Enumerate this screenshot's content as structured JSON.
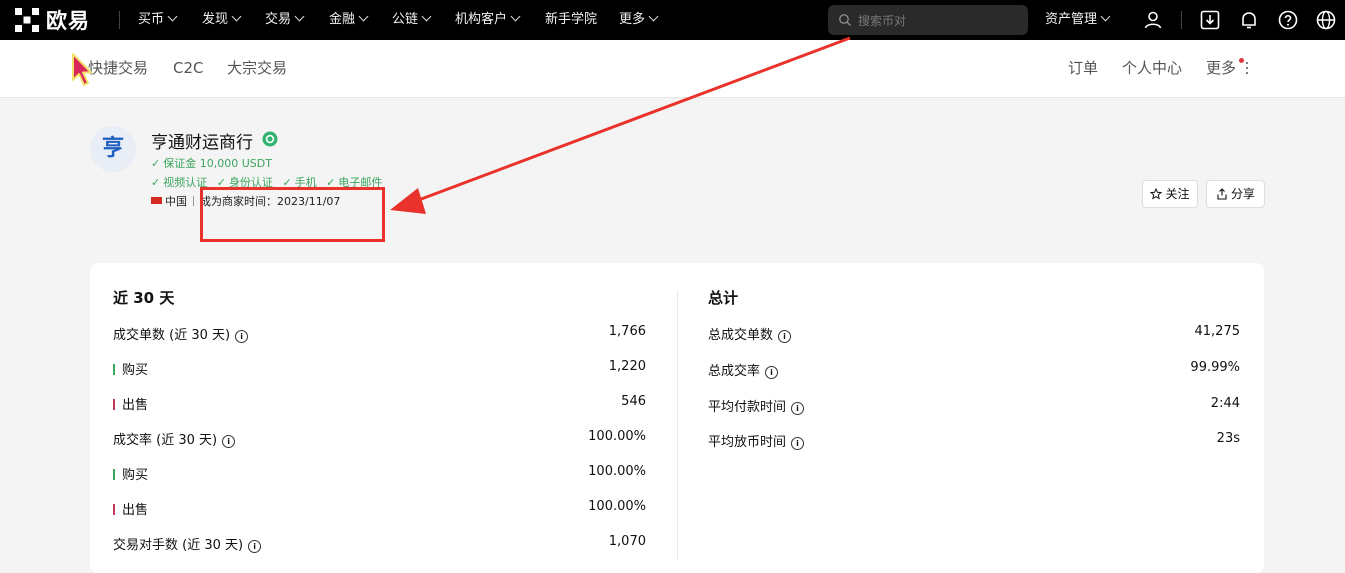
{
  "brand": {
    "name": "欧易"
  },
  "topnav": {
    "items": [
      "买币",
      "发现",
      "交易",
      "金融",
      "公链",
      "机构客户",
      "新手学院",
      "更多"
    ],
    "search_placeholder": "搜索币对",
    "assets_label": "资产管理",
    "icons": [
      "user-icon",
      "download-icon",
      "bell-icon",
      "help-icon",
      "globe-icon"
    ]
  },
  "subnav": {
    "left": [
      "快捷交易",
      "C2C",
      "大宗交易"
    ],
    "right": [
      "订单",
      "个人中心",
      "更多"
    ]
  },
  "merchant": {
    "avatar_char": "亨",
    "name": "亨通财运商行",
    "deposit": "保证金 10,000 USDT",
    "verifications": [
      "视频认证",
      "身份认证",
      "手机",
      "电子邮件"
    ],
    "country": "中国",
    "since": "成为商家时间：2023/11/07",
    "follow_label": "关注",
    "share_label": "分享"
  },
  "stats_30d": {
    "title": "近 30 天",
    "rows": [
      {
        "label": "成交单数 (近 30 天)",
        "value": "1,766",
        "info": true
      },
      {
        "label": "购买",
        "value": "1,220",
        "bar": "green"
      },
      {
        "label": "出售",
        "value": "546",
        "bar": "red"
      },
      {
        "label": "成交率 (近 30 天)",
        "value": "100.00%",
        "info": true
      },
      {
        "label": "购买",
        "value": "100.00%",
        "bar": "green"
      },
      {
        "label": "出售",
        "value": "100.00%",
        "bar": "red"
      },
      {
        "label": "交易对手数 (近 30 天)",
        "value": "1,070",
        "info": true
      }
    ]
  },
  "stats_total": {
    "title": "总计",
    "rows": [
      {
        "label": "总成交单数",
        "value": "41,275",
        "info": true
      },
      {
        "label": "总成交率",
        "value": "99.99%",
        "info": true
      },
      {
        "label": "平均付款时间",
        "value": "2:44",
        "info": true
      },
      {
        "label": "平均放币时间",
        "value": "23s",
        "info": true
      }
    ]
  },
  "annotation": {
    "color": "#e8322b"
  }
}
